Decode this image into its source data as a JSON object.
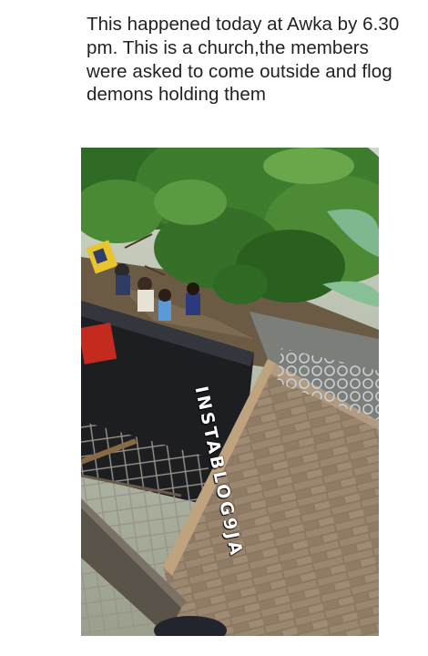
{
  "post": {
    "caption": "This happened today at Awka by 6.30 pm. This is a church,the members were asked to come outside and flog demons holding them"
  },
  "photo": {
    "watermark": "INSTABLOG9JA"
  },
  "colors": {
    "background": "#ffffff",
    "caption_text": "#222222",
    "foliage": "#3f7d2e",
    "wall": "#8a7660",
    "roof": "#1c1e22"
  }
}
